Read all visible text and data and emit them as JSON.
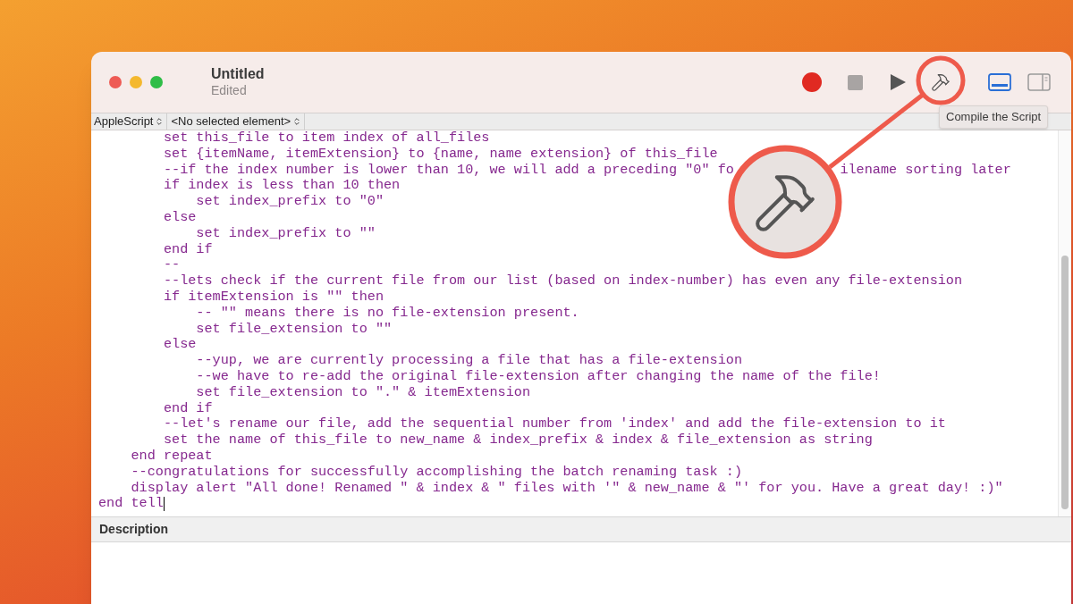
{
  "window": {
    "title": "Untitled",
    "subtitle": "Edited"
  },
  "toolbar": {
    "buttons": [
      {
        "kind": "record"
      },
      {
        "kind": "stop"
      },
      {
        "kind": "run"
      },
      {
        "kind": "compile"
      }
    ],
    "tooltip": "Compile the Script",
    "view_buttons": [
      {
        "kind": "bottom-pane",
        "selected": true
      },
      {
        "kind": "side-pane",
        "selected": false
      }
    ]
  },
  "navigation_bar": {
    "language": "AppleScript",
    "element": "<No selected element>"
  },
  "editor": {
    "cursor_at_end": true,
    "lines": [
      {
        "text": "        set this_file to item index of all_files"
      },
      {
        "text": "        set {itemName, itemExtension} to {name, name extension} of this_file"
      },
      {
        "text": "        --if the index number is lower than 10, we will add a preceding \"0\" fo",
        "text_after_overlay": "ilename sorting later"
      },
      {
        "text": "        if index is less than 10 then"
      },
      {
        "text": "            set index_prefix to \"0\""
      },
      {
        "text": "        else"
      },
      {
        "text": "            set index_prefix to \"\""
      },
      {
        "text": "        end if"
      },
      {
        "text": "        --"
      },
      {
        "text": "        --lets check if the current file from our list (based on index-number) has even any file-extension"
      },
      {
        "text": "        if itemExtension is \"\" then"
      },
      {
        "text": "            -- \"\" means there is no file-extension present."
      },
      {
        "text": "            set file_extension to \"\""
      },
      {
        "text": "        else"
      },
      {
        "text": "            --yup, we are currently processing a file that has a file-extension"
      },
      {
        "text": "            --we have to re-add the original file-extension after changing the name of the file!"
      },
      {
        "text": "            set file_extension to \".\" & itemExtension"
      },
      {
        "text": "        end if"
      },
      {
        "text": "        --let's rename our file, add the sequential number from 'index' and add the file-extension to it"
      },
      {
        "text": "        set the name of this_file to new_name & index_prefix & index & file_extension as string"
      },
      {
        "text": "    end repeat"
      },
      {
        "text": "    --congratulations for successfully accomplishing the batch renaming task :)"
      },
      {
        "text": "    display alert \"All done! Renamed \" & index & \" files with '\" & new_name & \"' for you. Have a great day! :)\""
      },
      {
        "text": "end tell"
      }
    ]
  },
  "description_pane": {
    "title": "Description"
  }
}
